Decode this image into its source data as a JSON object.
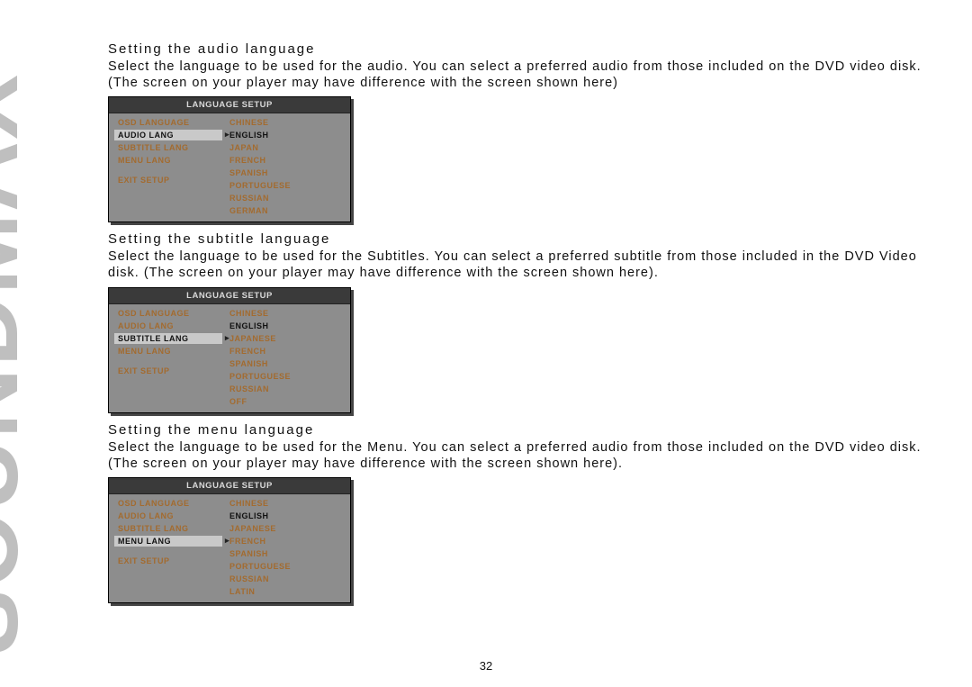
{
  "brand": "SOUNDMAX",
  "page_number": "32",
  "sections": [
    {
      "title": "Setting the audio language",
      "body": "Select the language to be used for the audio. You can select a preferred audio from those included on the DVD video disk. (The screen on your player may have difference with the screen shown here)",
      "panel": {
        "header": "LANGUAGE SETUP",
        "left": [
          "OSD LANGUAGE",
          "AUDIO LANG",
          "SUBTITLE LANG",
          "MENU LANG"
        ],
        "selected_index": 1,
        "exit": "EXIT  SETUP",
        "right": [
          "CHINESE",
          "ENGLISH",
          "JAPAN",
          "FRENCH",
          "SPANISH",
          "PORTUGUESE",
          "RUSSIAN",
          "GERMAN"
        ],
        "right_highlight_index": 1
      }
    },
    {
      "title": "Setting the subtitle language",
      "body": "Select the language to be used for the Subtitles. You can select a preferred subtitle from those included in the DVD Video disk. (The screen on your player may have difference with the screen shown here).",
      "panel": {
        "header": "LANGUAGE SETUP",
        "left": [
          "OSD LANGUAGE",
          "AUDIO LANG",
          "SUBTITLE LANG",
          "MENU LANG"
        ],
        "selected_index": 2,
        "exit": "EXIT  SETUP",
        "right": [
          "CHINESE",
          "ENGLISH",
          "JAPANESE",
          "FRENCH",
          "SPANISH",
          "PORTUGUESE",
          "RUSSIAN",
          "OFF"
        ],
        "right_highlight_index": 1
      }
    },
    {
      "title": "Setting the menu language",
      "body": "Select the language to be used for the Menu. You can select a preferred audio from those included on the DVD video disk.\n(The screen on your player may have difference with the screen shown here).",
      "panel": {
        "header": "LANGUAGE SETUP",
        "left": [
          "OSD LANGUAGE",
          "AUDIO LANG",
          "SUBTITLE LANG",
          "MENU LANG"
        ],
        "selected_index": 3,
        "exit": "EXIT  SETUP",
        "right": [
          "CHINESE",
          "ENGLISH",
          "JAPANESE",
          "FRENCH",
          "SPANISH",
          "PORTUGUESE",
          "RUSSIAN",
          "LATIN"
        ],
        "right_highlight_index": 1
      }
    }
  ]
}
